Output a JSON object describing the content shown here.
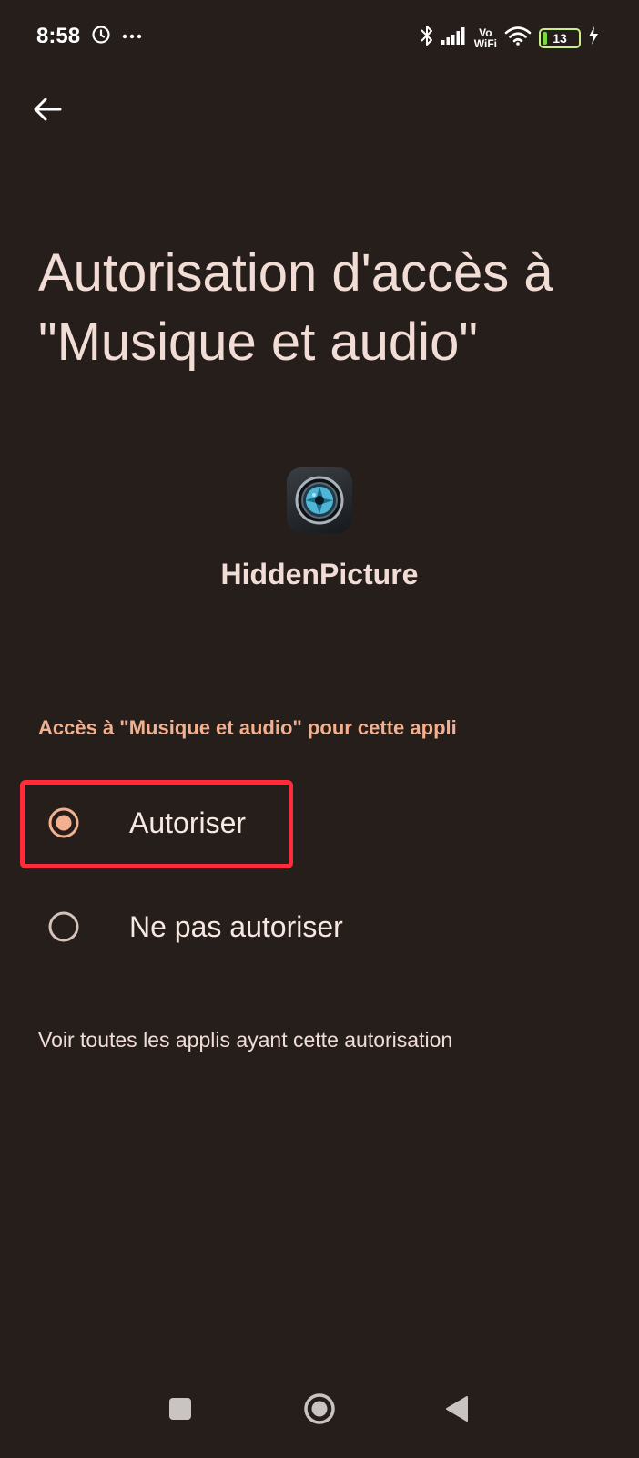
{
  "status_bar": {
    "time": "8:58",
    "vowifi_top": "Vo",
    "vowifi_bottom": "WiFi",
    "battery_level": "13",
    "battery_fraction": 0.13
  },
  "page": {
    "title": "Autorisation d'accès à \"Musique et audio\""
  },
  "app": {
    "name": "HiddenPicture",
    "icon": "camera-aperture-icon"
  },
  "permission": {
    "section_header": "Accès à \"Musique et audio\" pour cette appli",
    "options": [
      {
        "label": "Autoriser",
        "selected": true
      },
      {
        "label": "Ne pas autoriser",
        "selected": false
      }
    ],
    "see_all_label": "Voir toutes les applis ayant cette autorisation"
  },
  "colors": {
    "background": "#261e1b",
    "accent": "#f2b08f",
    "highlight": "#ff2d3b",
    "text": "#f2ddd6"
  }
}
